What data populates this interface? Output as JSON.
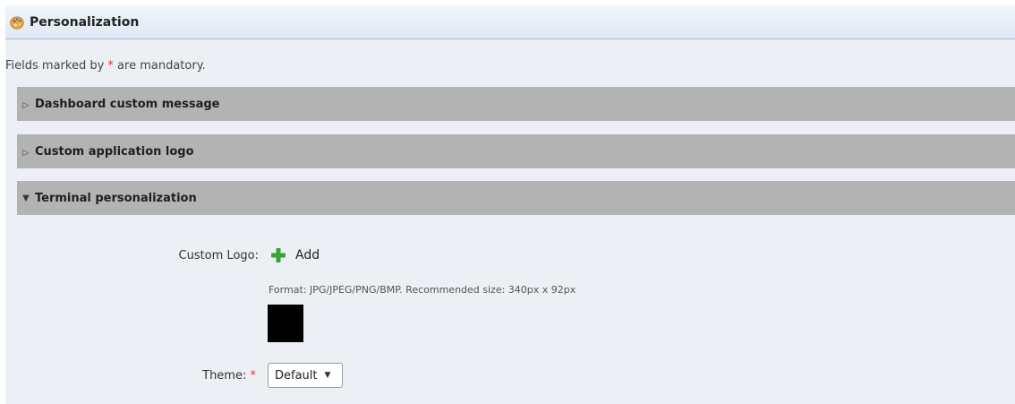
{
  "header": {
    "title": "Personalization",
    "icon": "palette-icon"
  },
  "notice": {
    "prefix": "Fields marked by ",
    "star": "*",
    "suffix": " are mandatory."
  },
  "sections": [
    {
      "label": "Dashboard custom message",
      "state": "collapsed",
      "arrow": "▷"
    },
    {
      "label": "Custom application logo",
      "state": "collapsed",
      "arrow": "▷"
    },
    {
      "label": "Terminal personalization",
      "state": "expanded",
      "arrow": "▼"
    }
  ],
  "terminal": {
    "custom_logo_label": "Custom Logo:",
    "add_label": "Add",
    "format_hint": "Format: JPG/JPEG/PNG/BMP. Recommended size: 340px x 92px",
    "theme_label": "Theme:",
    "theme_star": "*",
    "theme_value": "Default"
  },
  "colors": {
    "accent_required": "#d9392b",
    "section_bar": "#b3b3b3",
    "add_icon": "#3aa335"
  }
}
